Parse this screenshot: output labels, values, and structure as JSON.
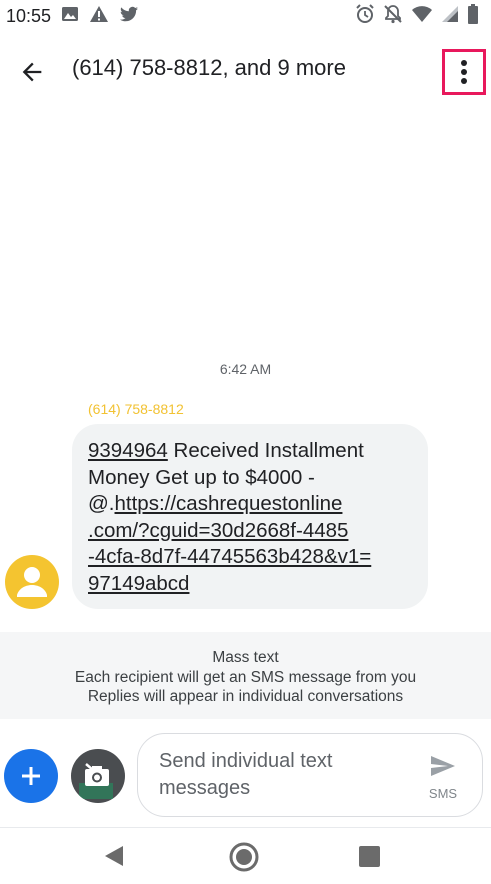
{
  "status_bar": {
    "time": "10:55",
    "left_icons": [
      "image-icon",
      "warning-icon",
      "twitter-icon"
    ],
    "right_icons": [
      "alarm-icon",
      "notifications-off-icon",
      "wifi-icon",
      "signal-icon",
      "battery-icon"
    ]
  },
  "app_bar": {
    "title": "(614) 758-8812, and 9 more",
    "back_icon": "arrow-back-icon",
    "more_icon": "more-vert-icon"
  },
  "conversation": {
    "timestamp": "6:42 AM",
    "messages": [
      {
        "sender": "(614) 758-8812",
        "code": "9394964",
        "text_line1_rest": " Received Installment",
        "text_line2": "Money Get up to $4000 -",
        "text_line3_prefix": "@.",
        "link_line3": "https://cashrequestonline",
        "link_line4": ".com/?cguid=30d2668f-4485",
        "link_line5": "-4cfa-8d7f-44745563b428&v1=",
        "link_line6": "97149abcd"
      }
    ]
  },
  "mass_text": {
    "title": "Mass text",
    "line1": "Each recipient will get an SMS message from you",
    "line2": "Replies will appear in individual conversations"
  },
  "composer": {
    "add_icon": "add-icon",
    "camera_icon": "camera-icon",
    "placeholder_line1": "Send individual text",
    "placeholder_line2": "messages",
    "send_label": "SMS",
    "send_icon": "send-icon"
  },
  "nav_bar": {
    "icons": [
      "nav-back-icon",
      "nav-home-icon",
      "nav-recents-icon"
    ]
  },
  "colors": {
    "accent_blue": "#1a73e8",
    "highlight_pink": "#e8185c",
    "sender_yellow": "#f2c232",
    "avatar_yellow": "#f4c430",
    "bubble_gray": "#f1f3f4"
  }
}
